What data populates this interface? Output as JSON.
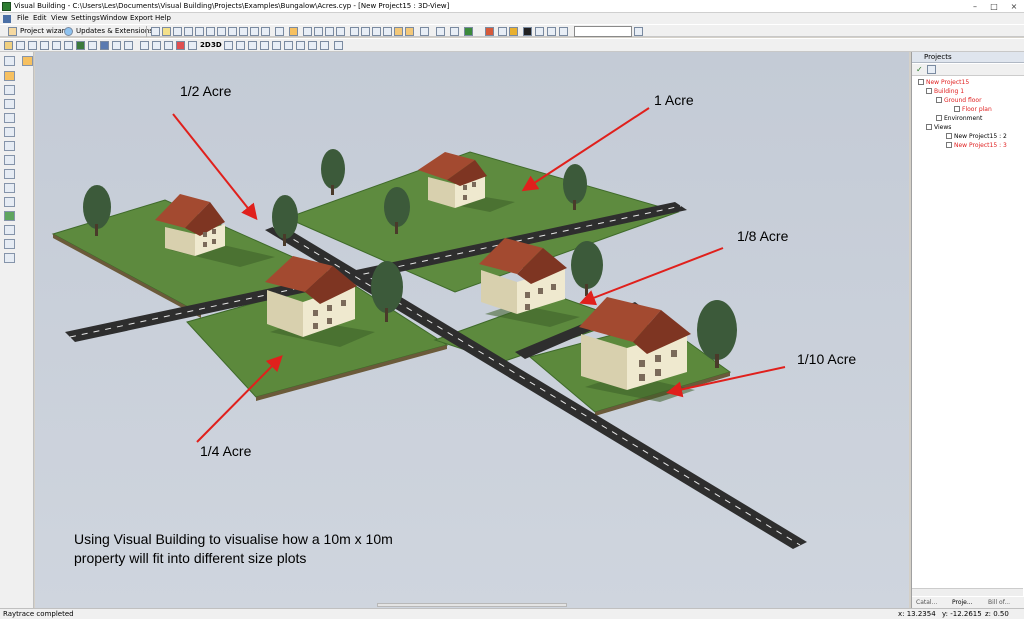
{
  "window": {
    "title": "Visual Building - C:\\Users\\Les\\Documents\\Visual Building\\Projects\\Examples\\Bungalow\\Acres.cyp - [New Project15 : 3D-View]",
    "controls": [
      "–",
      "□",
      "×"
    ]
  },
  "menu": [
    "File",
    "Edit",
    "View",
    "Settings",
    "Window",
    "Export",
    "Help"
  ],
  "toolbar": {
    "project_wizard": "Project wizard",
    "updates": "Updates & Extensions",
    "view_2d": "2D",
    "view_3d": "3D"
  },
  "viewport": {
    "labels": {
      "half_acre": "1/2 Acre",
      "one_acre": "1 Acre",
      "eighth_acre": "1/8 Acre",
      "tenth_acre": "1/10 Acre",
      "quarter_acre": "1/4 Acre"
    },
    "caption_line1": "Using Visual Building to visualise how a 10m x 10m",
    "caption_line2": "property will fit into different size plots"
  },
  "projects_panel": {
    "title": "Projects",
    "tree": {
      "project": "New Project15",
      "building": "Building 1",
      "ground_floor": "Ground floor",
      "floor_plan": "Floor plan",
      "environment": "Environment",
      "views": "Views",
      "view_2d": "New Project15 : 2",
      "view_3d": "New Project15 : 3"
    },
    "tabs": [
      "Catal...",
      "Proje...",
      "Bill of..."
    ]
  },
  "status": {
    "message": "Raytrace completed",
    "x": "x: 13.2354",
    "y": "y: -12.2615",
    "z": "z: 0.50"
  },
  "colors": {
    "grass": "#5f8a3e",
    "road": "#2e2e2e",
    "wall": "#eee8cc",
    "roof": "#8b3a26",
    "arrow": "#e0201c",
    "sky": "#c9d0da"
  }
}
